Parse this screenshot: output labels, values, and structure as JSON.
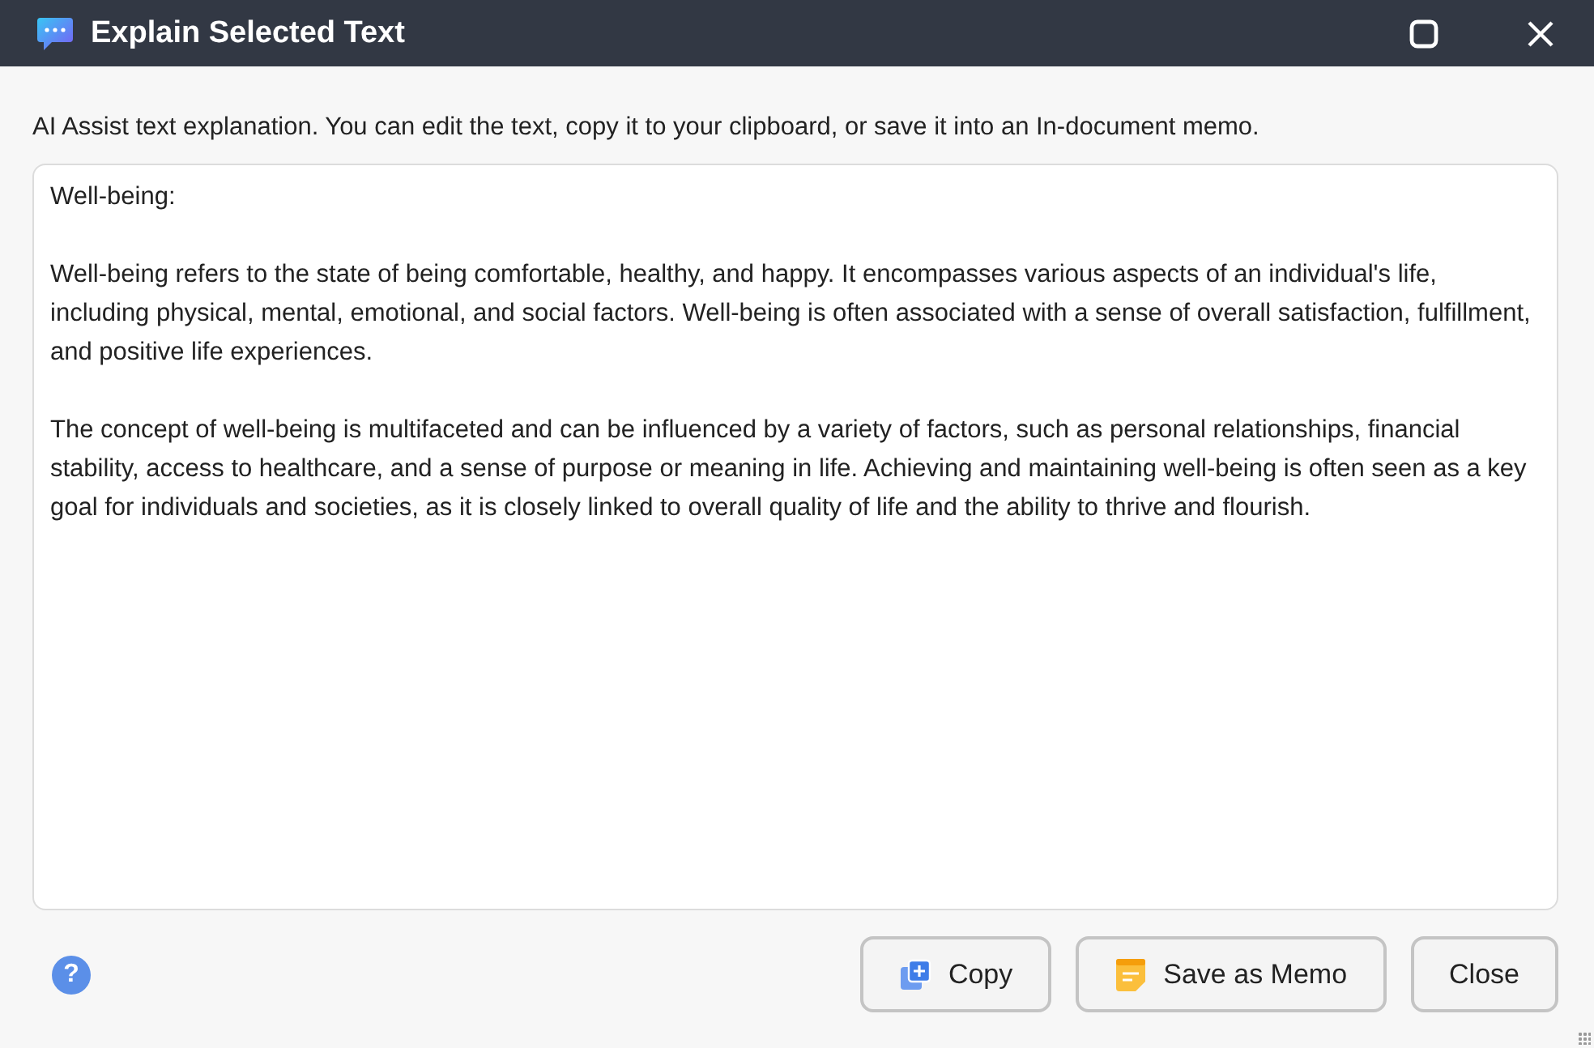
{
  "window": {
    "title": "Explain Selected Text"
  },
  "description": "AI Assist text explanation. You can edit the text, copy it to your clipboard, or save it into an In-document memo.",
  "editor": {
    "value": "Well-being:\n\nWell-being refers to the state of being comfortable, healthy, and happy. It encompasses various aspects of an individual's life, including physical, mental, emotional, and social factors. Well-being is often associated with a sense of overall satisfaction, fulfillment, and positive life experiences.\n\nThe concept of well-being is multifaceted and can be influenced by a variety of factors, such as personal relationships, financial stability, access to healthcare, and a sense of purpose or meaning in life. Achieving and maintaining well-being is often seen as a key goal for individuals and societies, as it is closely linked to overall quality of life and the ability to thrive and flourish."
  },
  "help": "?",
  "buttons": [
    {
      "kind": "copy",
      "label": "Copy"
    },
    {
      "kind": "memo",
      "label": "Save as Memo"
    },
    {
      "kind": "close",
      "label": "Close"
    }
  ]
}
